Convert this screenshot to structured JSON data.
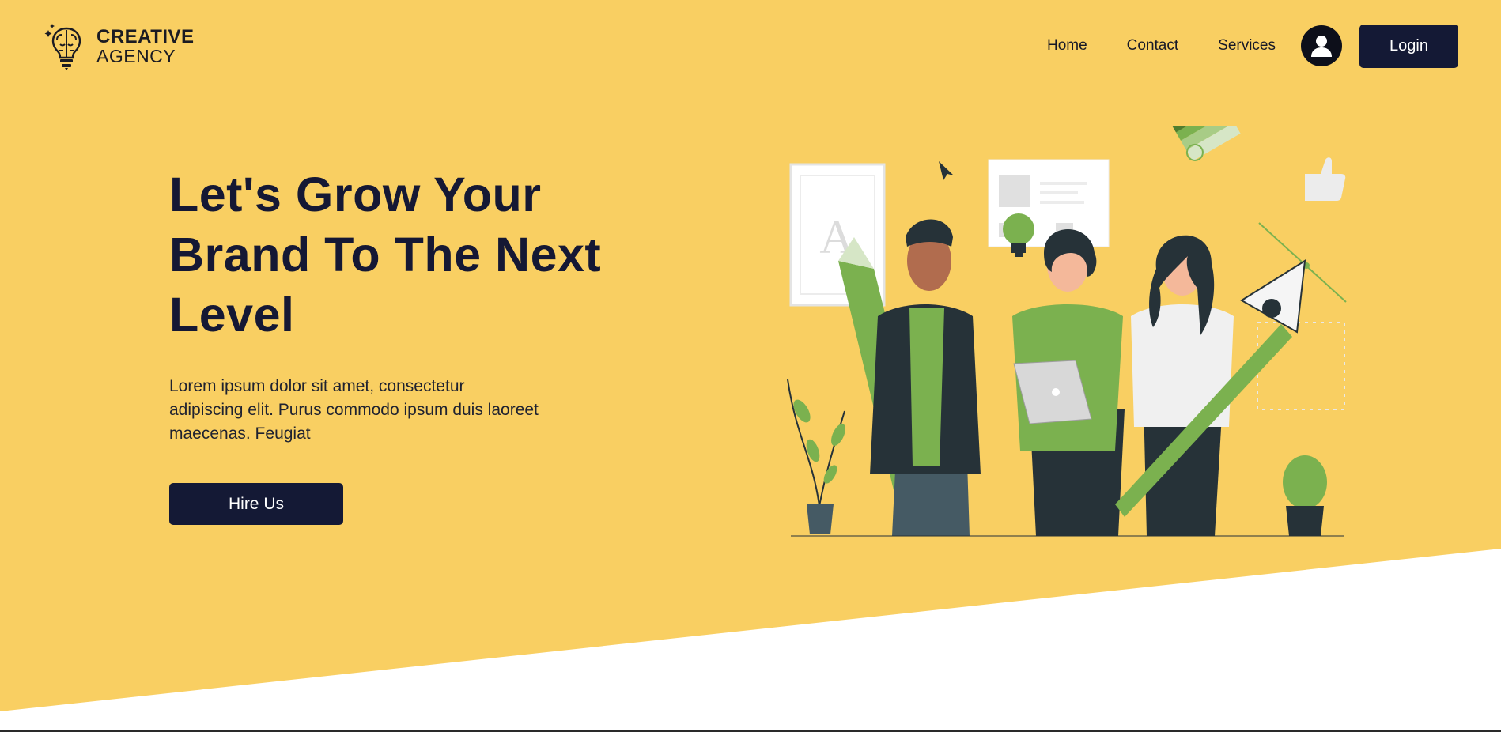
{
  "brand": {
    "name_line1": "CREATIVE",
    "name_line2": "AGENCY"
  },
  "nav": {
    "items": [
      {
        "label": "Home"
      },
      {
        "label": "Contact"
      },
      {
        "label": "Services"
      }
    ],
    "login_label": "Login",
    "user_icon": "user-circle-icon"
  },
  "hero": {
    "title": "Let's Grow Your Brand To The Next Level",
    "description": "Lorem ipsum dolor sit amet, consectetur adipiscing elit. Purus commodo ipsum duis laoreet maecenas. Feugiat",
    "cta_label": "Hire Us"
  },
  "colors": {
    "background": "#f9cf62",
    "primary": "#141935",
    "accent_green": "#7bb14f"
  }
}
